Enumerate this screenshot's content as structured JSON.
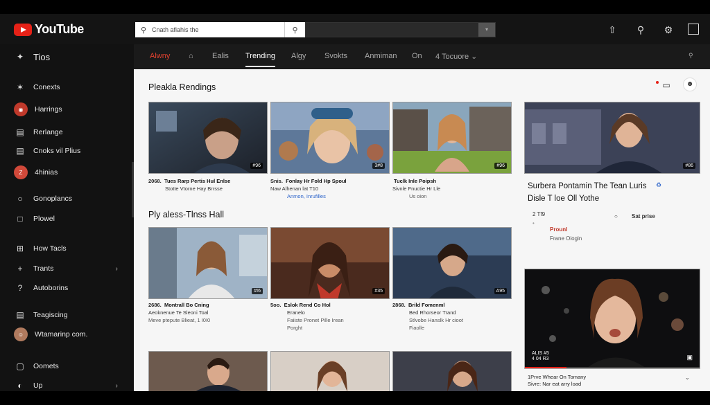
{
  "header": {
    "logo_text": "YouTube",
    "search_placeholder": "Cnath afiahis the",
    "icons": [
      "upload-icon",
      "search-icon",
      "settings-icon",
      "fullscreen-icon"
    ]
  },
  "sidebar": {
    "top_label": "Tios",
    "items": [
      {
        "label": "Conexts",
        "icon": "star-icon"
      },
      {
        "label": "Harrings",
        "icon": "avatar"
      },
      {
        "label": "Rerlange",
        "icon": "calendar-icon"
      },
      {
        "label": "Cnoks vil Plius",
        "icon": "document-icon"
      },
      {
        "label": "4hinias",
        "icon": "avatar"
      },
      {
        "label": "Gonoplancs",
        "icon": "chat-icon"
      },
      {
        "label": "Plowel",
        "icon": "flag-icon"
      },
      {
        "label": "How Tacls",
        "icon": "grid-icon"
      },
      {
        "label": "Trants",
        "icon": "plus-icon"
      },
      {
        "label": "Autoborins",
        "icon": "question-icon"
      },
      {
        "label": "Teagiscing",
        "icon": "list-icon"
      },
      {
        "label": "Wtamarinp com.",
        "icon": "avatar"
      },
      {
        "label": "Oomets",
        "icon": "square-icon"
      },
      {
        "label": "Up",
        "icon": "headphones-icon"
      }
    ]
  },
  "tabs": [
    {
      "label": "Alwny"
    },
    {
      "label": "⌂"
    },
    {
      "label": "Ealis"
    },
    {
      "label": "Trending"
    },
    {
      "label": "Algy"
    },
    {
      "label": "Svokts"
    },
    {
      "label": "Anmiman"
    },
    {
      "label": "On"
    },
    {
      "label": "4 Tocuore ⌄"
    }
  ],
  "section1": {
    "title": "Pleakla Rendings",
    "videos": [
      {
        "duration": "#96",
        "m1a": "2068.",
        "m1b": "Tues Rarp Pertis Hul Enlse",
        "m2": "Stotte Vtorne Hay Brrsse",
        "m3": ""
      },
      {
        "duration": "3#8",
        "m1a": "Snis.",
        "m1b": "Fonlay Hr Fold Hp Spoul",
        "m2": "Naw   Alhenan lat T10",
        "m3": "Anmon, Inrufilles"
      },
      {
        "duration": "#96",
        "m1a": "",
        "m1b": "Tuclk Inle Poipsh",
        "m2": "Sivnle Fnuctie Hr Lle",
        "m3": "Us oion"
      }
    ]
  },
  "section2": {
    "title": "Ply aless-Tlnss Hall",
    "videos": [
      {
        "duration": "#I6",
        "m1a": "2686.",
        "m1b": "Montrall Bo Cning",
        "m2": "Aeoknenue Te Sleoni Toal",
        "m3": "Meve ptepute Blieat, 1 I0I0"
      },
      {
        "duration": "#35",
        "m1a": "5oo.",
        "m1b": "Eslok Rend Co Hol",
        "m2": "Eranelo",
        "m3": "Faiiste Pronet Pille Irean"
      },
      {
        "duration": "A95",
        "m1a": "2868.",
        "m1b": "Brild Fomenml",
        "m2": "Bed Rhorseor Trand",
        "m3": "Stlvobe Hanslk Hr cioot"
      }
    ],
    "extra": [
      "",
      "Porght",
      "Fiaolle"
    ]
  },
  "right_panel": {
    "video_duration": "#86",
    "title_line1": "Surbera Pontamin The Tean Luris",
    "title_line2": "Disle T loe Oll Yothe",
    "stat": "2 Tf9",
    "channel": "Sat prise",
    "label_red": "Prounl",
    "sub": "Frane Oiogin",
    "featured_caption": "ALIS #5\n4 04 R3",
    "foot_line1": "1Prve Whear On Tomany",
    "foot_line2": "Sivre: Nar eat arry load"
  },
  "colors": {
    "accent_red": "#e62117",
    "tab_red": "#e0412f",
    "link_blue": "#2a62c9"
  }
}
